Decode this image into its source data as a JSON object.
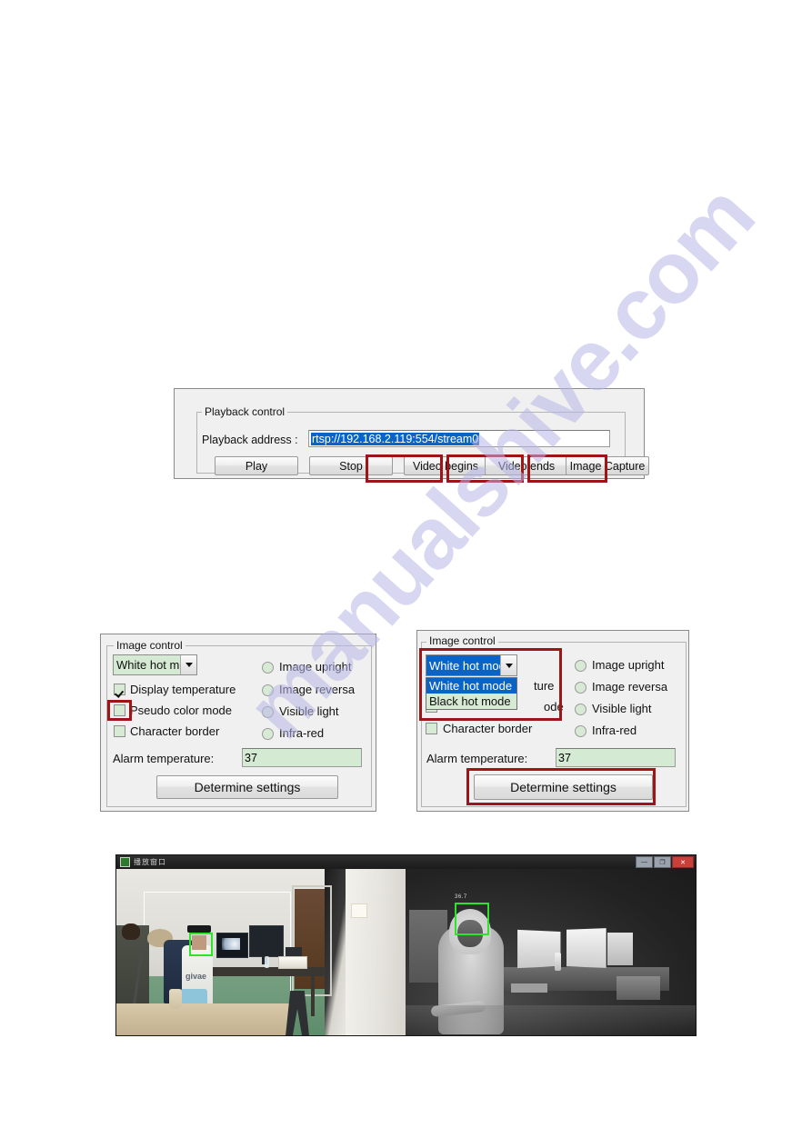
{
  "playback_panel": {
    "group_title": "Playback control",
    "address_label": "Playback address :",
    "address_value": "rtsp://192.168.2.119:554/stream0",
    "buttons": {
      "play": "Play",
      "stop": "Stop",
      "video_begins": "Video begins",
      "video_ends": "Video ends",
      "image_capture": "Image Capture"
    }
  },
  "image_control_left": {
    "group_title": "Image control",
    "mode_combo_value": "White hot mod",
    "checkboxes": [
      {
        "label": "Display temperature",
        "checked": true
      },
      {
        "label": "Pseudo color mode",
        "checked": false
      },
      {
        "label": "Character border",
        "checked": false
      }
    ],
    "radios": [
      {
        "label": "Image upright",
        "selected": false
      },
      {
        "label": "Image reversa",
        "selected": false
      },
      {
        "label": "Visible light",
        "selected": false
      },
      {
        "label": "Infra-red",
        "selected": false
      }
    ],
    "alarm_label": "Alarm temperature:",
    "alarm_value": "37",
    "determine_button": "Determine settings"
  },
  "image_control_right": {
    "group_title": "Image control",
    "mode_combo_value": "White hot mod",
    "dropdown_options": [
      {
        "label": "White hot mode",
        "selected": true
      },
      {
        "label": "Black hot mode",
        "selected": false
      }
    ],
    "occluded_labels": {
      "display_temperature_tail": "ture",
      "pseudo_color_tail": "ode",
      "character_border": "Character border"
    },
    "radios": [
      {
        "label": "Image upright",
        "selected": false
      },
      {
        "label": "Image reversa",
        "selected": false
      },
      {
        "label": "Visible light",
        "selected": false
      },
      {
        "label": "Infra-red",
        "selected": false
      }
    ],
    "alarm_label": "Alarm temperature:",
    "alarm_value": "37",
    "determine_button": "Determine settings"
  },
  "video_window": {
    "title": "播放窗口",
    "titlebar_buttons": {
      "minimize": "—",
      "maximize": "❐",
      "close": "✕"
    },
    "panes": {
      "left": "visible-light-view",
      "right": "infra-red-thermal-view"
    },
    "thermal_overlay_temp": "36.7",
    "hoodie_text": "givae"
  },
  "watermark": {
    "text": "manualshive.com"
  },
  "colors": {
    "annotation_red": "#9e1518",
    "selection_blue": "#0a64c8",
    "field_green": "#d5ead3",
    "detection_green": "#2ae52a",
    "panel_gray": "#f0f0f0"
  }
}
